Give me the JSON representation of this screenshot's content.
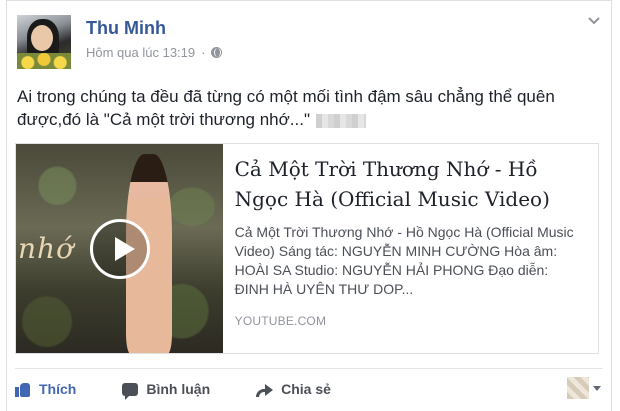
{
  "post": {
    "author": "Thu Minh",
    "timestamp": "Hôm qua lúc 13:19",
    "audience_icon": "globe-icon",
    "menu_icon": "chevron-down-icon",
    "text": "Ai trong chúng ta đều đã từng có một mối tình đậm sâu chẳng thể quên được,đó là \"Cả một trời thương nhớ...\""
  },
  "link_preview": {
    "title": "Cả Một Trời Thương Nhớ - Hồ Ngọc Hà (Official Music Video)",
    "description": "Cả Một Trời Thương Nhớ - Hồ Ngọc Hà (Official Music Video) Sáng tác: NGUYỄN MINH CƯỜNG Hòa âm: HOÀI SA Studio: NGUYỄN HẢI PHONG Đạo diễn: ĐINH HÀ UYÊN THƯ DOP...",
    "domain": "YOUTUBE.COM",
    "thumbnail_script_text": "nhớ",
    "play_icon": "play-icon"
  },
  "actions": {
    "like_label": "Thích",
    "comment_label": "Bình luận",
    "share_label": "Chia sẻ"
  },
  "colors": {
    "author_link": "#365899",
    "like_active": "#4267b2",
    "meta_gray": "#90949c"
  }
}
